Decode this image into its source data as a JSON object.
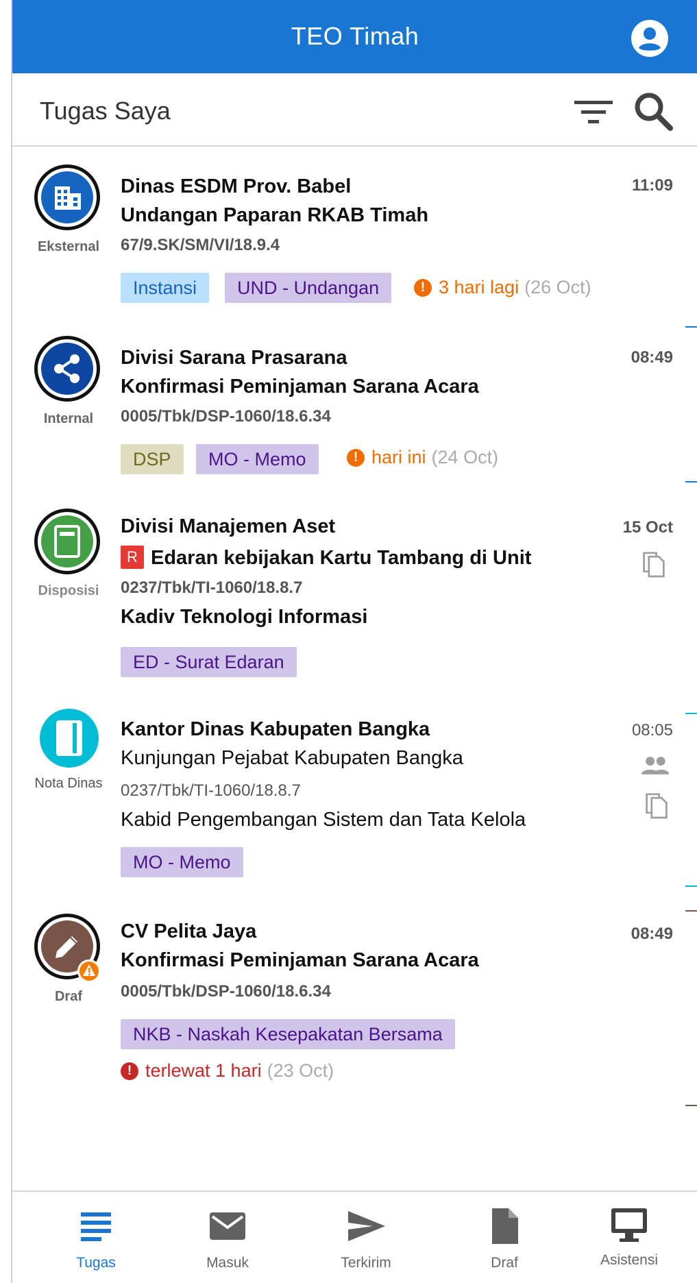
{
  "app": {
    "title": "TEO Timah",
    "account_icon": "account-circle-icon",
    "brand_color": "#1976d2"
  },
  "toolbar": {
    "heading": "Tugas Saya",
    "filter_icon": "filter-icon",
    "search_icon": "search-icon"
  },
  "items": [
    {
      "avatar_label": "Eksternal",
      "avatar_icon": "building-icon",
      "sender": "Dinas ESDM Prov. Babel",
      "subject": "Undangan Paparan RKAB Timah",
      "ref": "67/9.SK/SM/VI/18.9.4",
      "time": "11:09",
      "tags": [
        "Instansi",
        "UND - Undangan"
      ],
      "due_text": "3 hari lagi",
      "due_date": "(26 Oct)",
      "due_icon": "!"
    },
    {
      "avatar_label": "Internal",
      "avatar_icon": "share-icon",
      "sender": "Divisi Sarana Prasarana",
      "subject": "Konfirmasi Peminjaman Sarana Acara",
      "ref": "0005/Tbk/DSP-1060/18.6.34",
      "time": "08:49",
      "tags": [
        "DSP",
        "MO - Memo"
      ],
      "due_text": "hari ini",
      "due_date": "(24 Oct)",
      "due_icon": "!"
    },
    {
      "avatar_label": "Disposisi",
      "avatar_icon": "document-icon",
      "sender": "Divisi Manajemen Aset",
      "badge": "R",
      "subject": "Edaran kebijakan Kartu Tambang di Unit",
      "ref": "0237/Tbk/TI-1060/18.8.7",
      "person": "Kadiv Teknologi Informasi",
      "time": "15 Oct",
      "tags": [
        "ED - Surat Edaran"
      ],
      "side_icons": [
        "copy-icon"
      ]
    },
    {
      "avatar_label": "Nota Dinas",
      "avatar_icon": "book-icon",
      "sender": "Kantor Dinas Kabupaten Bangka",
      "subject": "Kunjungan Pejabat Kabupaten Bangka",
      "ref": "0237/Tbk/TI-1060/18.8.7",
      "person": "Kabid Pengembangan Sistem dan Tata Kelola",
      "time": "08:05",
      "tags": [
        "MO - Memo"
      ],
      "side_icons": [
        "people-icon",
        "copy-icon"
      ]
    },
    {
      "avatar_label": "Draf",
      "avatar_icon": "pencil-icon",
      "warning_icon": "warning-icon",
      "sender": "CV Pelita Jaya",
      "subject": "Konfirmasi Peminjaman Sarana Acara",
      "ref": "0005/Tbk/DSP-1060/18.6.34",
      "time": "08:49",
      "tags": [
        "NKB - Naskah Kesepakatan Bersama"
      ],
      "due_text": "terlewat 1 hari",
      "due_date": "(23 Oct)",
      "due_icon": "!"
    }
  ],
  "nav": [
    {
      "label": "Tugas",
      "icon": "list-icon",
      "active": true
    },
    {
      "label": "Masuk",
      "icon": "mail-icon",
      "active": false
    },
    {
      "label": "Terkirim",
      "icon": "send-icon",
      "active": false
    },
    {
      "label": "Draf",
      "icon": "file-icon",
      "active": false
    },
    {
      "label": "Asistensi",
      "icon": "monitor-icon",
      "active": false
    }
  ]
}
